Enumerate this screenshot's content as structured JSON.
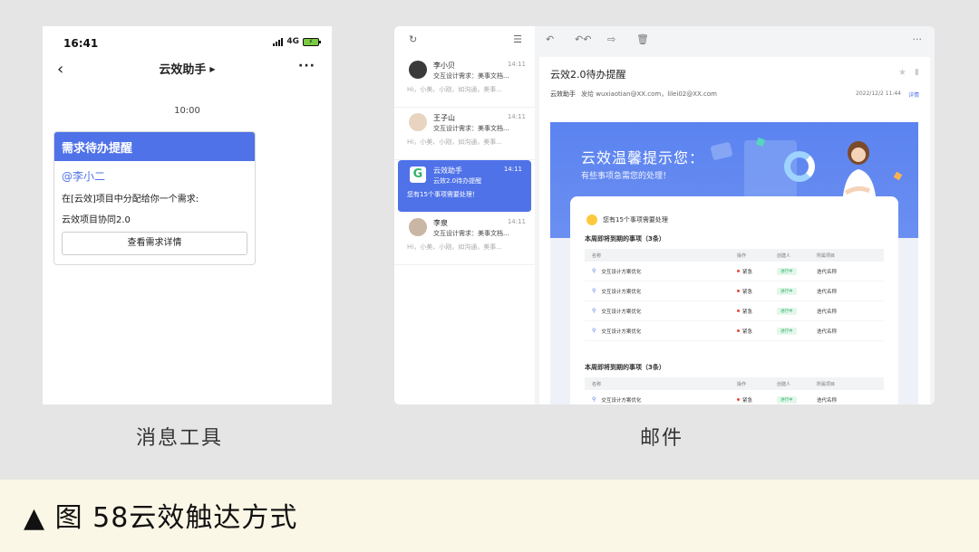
{
  "phone": {
    "status_time": "16:41",
    "network": "4G",
    "chat_title": "云效助手",
    "chat_time": "10:00",
    "card": {
      "title": "需求待办提醒",
      "mention": "@李小二",
      "line1": "在[云效]项目中分配给你一个需求:",
      "line2": "云效项目协同2.0",
      "button": "查看需求详情"
    },
    "caption": "消息工具"
  },
  "mail": {
    "list": [
      {
        "sender": "李小贝",
        "time": "14:11",
        "subject": "交互设计需求：美事文档...",
        "preview": "Hi，小美、小刚，如沟通，美事..."
      },
      {
        "sender": "王子山",
        "time": "14:11",
        "subject": "交互设计需求：美事文档...",
        "preview": "Hi，小美、小刚，如沟通，美事..."
      },
      {
        "sender": "云效助手",
        "time": "14:11",
        "subject": "云效2.0待办提醒",
        "preview": "您有15个事项需要处理！"
      },
      {
        "sender": "李泉",
        "time": "14:11",
        "subject": "交互设计需求：美事文档...",
        "preview": "Hi，小美、小刚，如沟通，美事..."
      }
    ],
    "detail": {
      "subject": "云效2.0待办提醒",
      "from": "云效助手",
      "to_line": "发给 wuxiaotian@XX.com，lilei02@XX.com",
      "date": "2022/12/2 11:44",
      "detail_link": "详情",
      "banner_title": "云效温馨提示您：",
      "banner_sub": "有些事项急需您的处理！",
      "count_text": "您有15个事项需要处理",
      "section1": "本周即将到期的事项（3条）",
      "section2": "本周即将到期的事项（3条）",
      "columns": [
        "名称",
        "操作",
        "创建人",
        "所属项目"
      ],
      "rows": [
        {
          "name": "交互设计方案优化",
          "priority": "紧急",
          "status": "进行中",
          "project": "迭代名称"
        },
        {
          "name": "交互设计方案优化",
          "priority": "紧急",
          "status": "进行中",
          "project": "迭代名称"
        },
        {
          "name": "交互设计方案优化",
          "priority": "紧急",
          "status": "进行中",
          "project": "迭代名称"
        },
        {
          "name": "交互设计方案优化",
          "priority": "紧急",
          "status": "进行中",
          "project": "迭代名称"
        }
      ],
      "rows2": [
        {
          "name": "交互设计方案优化",
          "priority": "紧急",
          "status": "进行中",
          "project": "迭代名称"
        }
      ]
    },
    "caption": "邮件"
  },
  "footer": {
    "text": "▲ 图 58云效触达方式"
  },
  "colors": {
    "accent": "#4f72e8",
    "footer_bg": "#fbf7e6",
    "page_bg": "#e5e5e5"
  }
}
